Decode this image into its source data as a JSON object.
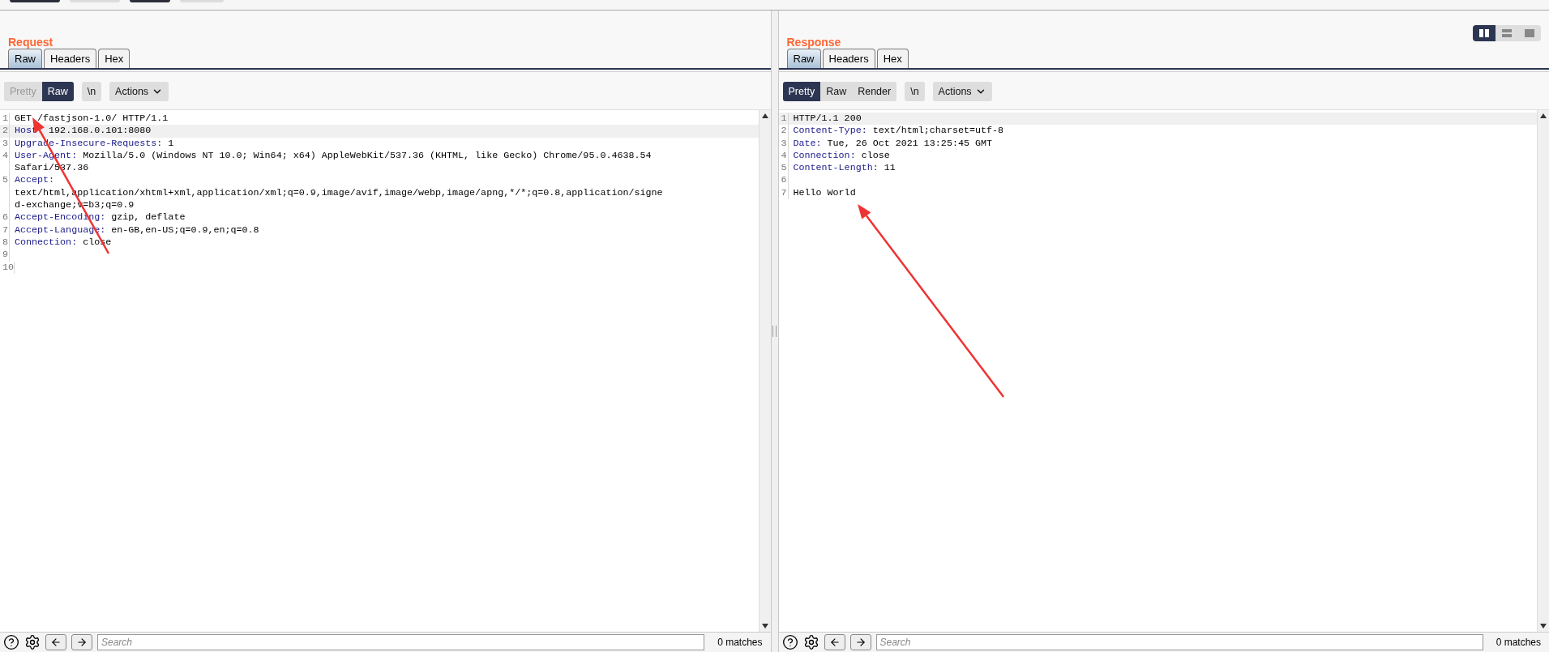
{
  "top_toolbar": [
    {
      "selected": true
    },
    {
      "selected": false
    },
    {
      "selected": true
    },
    {
      "selected": false
    }
  ],
  "request": {
    "title": "Request",
    "tabs": [
      {
        "label": "Raw",
        "selected": true
      },
      {
        "label": "Headers",
        "selected": false
      },
      {
        "label": "Hex",
        "selected": false
      }
    ],
    "view_buttons": [
      {
        "label": "Pretty",
        "selected": false,
        "disabled": true
      },
      {
        "label": "Raw",
        "selected": true,
        "disabled": false
      }
    ],
    "newline_button": "\\n",
    "actions_button": "Actions",
    "lines": [
      {
        "number": "1",
        "kind": "plain",
        "text": "GET /fastjson-1.0/ HTTP/1.1",
        "current": false
      },
      {
        "number": "2",
        "kind": "header",
        "name": "Host:",
        "value": "192.168.0.101:8080",
        "current": true
      },
      {
        "number": "3",
        "kind": "header",
        "name": "Upgrade-Insecure-Requests:",
        "value": "1",
        "current": false
      },
      {
        "number": "4",
        "kind": "header",
        "name": "User-Agent:",
        "value": "Mozilla/5.0 (Windows NT 10.0; Win64; x64) AppleWebKit/537.36 (KHTML, like Gecko) Chrome/95.0.4638.54",
        "wrapped": [
          "Safari/537.36"
        ],
        "current": false
      },
      {
        "number": "5",
        "kind": "header",
        "name": "Accept:",
        "wrapped": [
          "text/html,application/xhtml+xml,application/xml;q=0.9,image/avif,image/webp,image/apng,*/*;q=0.8,application/signe",
          "d-exchange;v=b3;q=0.9"
        ],
        "current": false
      },
      {
        "number": "6",
        "kind": "header",
        "name": "Accept-Encoding:",
        "value": "gzip, deflate",
        "current": false
      },
      {
        "number": "7",
        "kind": "header",
        "name": "Accept-Language:",
        "value": "en-GB,en-US;q=0.9,en;q=0.8",
        "current": false
      },
      {
        "number": "8",
        "kind": "header",
        "name": "Connection:",
        "value": "close",
        "current": false
      },
      {
        "number": "9",
        "kind": "blank",
        "current": false
      },
      {
        "number": "10",
        "kind": "blank",
        "current": false
      }
    ],
    "search": {
      "placeholder": "Search"
    },
    "matches": "0 matches"
  },
  "response": {
    "title": "Response",
    "layout_toggle": [
      {
        "selected": true
      },
      {
        "selected": false
      },
      {
        "selected": false
      }
    ],
    "tabs": [
      {
        "label": "Raw",
        "selected": true
      },
      {
        "label": "Headers",
        "selected": false
      },
      {
        "label": "Hex",
        "selected": false
      }
    ],
    "view_buttons": [
      {
        "label": "Pretty",
        "selected": true,
        "disabled": false
      },
      {
        "label": "Raw",
        "selected": false,
        "disabled": false
      },
      {
        "label": "Render",
        "selected": false,
        "disabled": false
      }
    ],
    "newline_button": "\\n",
    "actions_button": "Actions",
    "lines": [
      {
        "number": "1",
        "kind": "plain",
        "text": "HTTP/1.1 200",
        "current": true
      },
      {
        "number": "2",
        "kind": "header",
        "name": "Content-Type:",
        "value": "text/html;charset=utf-8",
        "current": false
      },
      {
        "number": "3",
        "kind": "header",
        "name": "Date:",
        "value": "Tue, 26 Oct 2021 13:25:45 GMT",
        "current": false
      },
      {
        "number": "4",
        "kind": "header",
        "name": "Connection:",
        "value": "close",
        "current": false
      },
      {
        "number": "5",
        "kind": "header",
        "name": "Content-Length:",
        "value": "11",
        "current": false
      },
      {
        "number": "6",
        "kind": "blank",
        "current": false
      },
      {
        "number": "7",
        "kind": "plain",
        "text": "Hello World",
        "current": false
      }
    ],
    "search": {
      "placeholder": "Search"
    },
    "matches": "0 matches"
  }
}
